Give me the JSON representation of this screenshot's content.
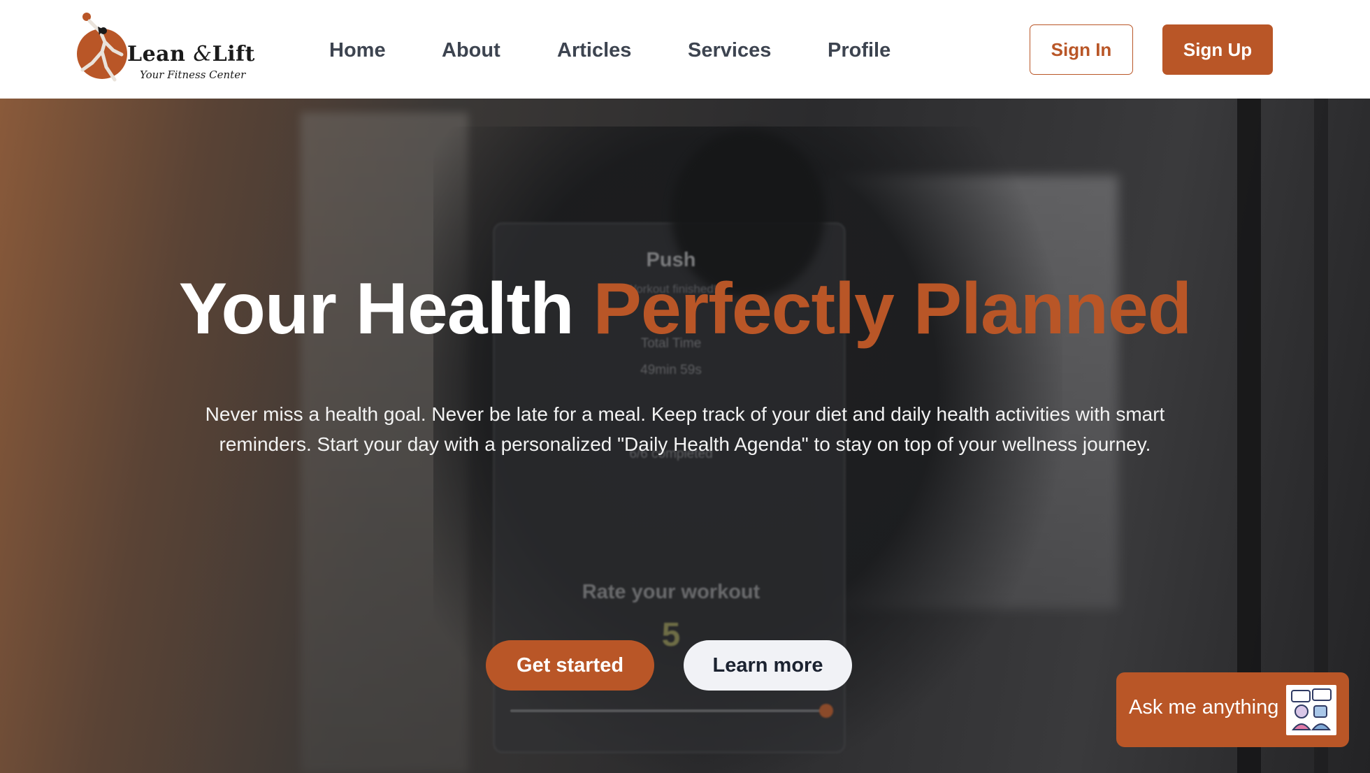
{
  "colors": {
    "accent": "#b95627",
    "nav_text": "#3d4450",
    "white": "#ffffff"
  },
  "logo": {
    "name_part1": "Lean",
    "amp": "&",
    "name_part2": "Lift",
    "tagline": "Your Fitness Center",
    "icon": "runner-logo-icon"
  },
  "nav": {
    "items": [
      {
        "label": "Home"
      },
      {
        "label": "About"
      },
      {
        "label": "Articles"
      },
      {
        "label": "Services"
      },
      {
        "label": "Profile"
      }
    ]
  },
  "auth": {
    "sign_in": "Sign In",
    "sign_up": "Sign Up"
  },
  "hero": {
    "title_white": "Your Health",
    "title_accent": "Perfectly Planned",
    "description": "Never miss a health goal. Never be late for a meal. Keep track of your diet and daily health activities with smart reminders. Start your day with a personalized \"Daily Health Agenda\" to stay on top of your wellness journey.",
    "cta_primary": "Get started",
    "cta_secondary": "Learn more"
  },
  "background_screen": {
    "title": "Push",
    "subtitle": "Workout finished!",
    "time_label": "Total Time",
    "time_value": "49min 59s",
    "completed": "6/6 completed",
    "rate_label": "Rate your workout",
    "rate_value": "5"
  },
  "chat": {
    "label": "Ask me anything",
    "icon": "chatbot-avatar-icon"
  }
}
